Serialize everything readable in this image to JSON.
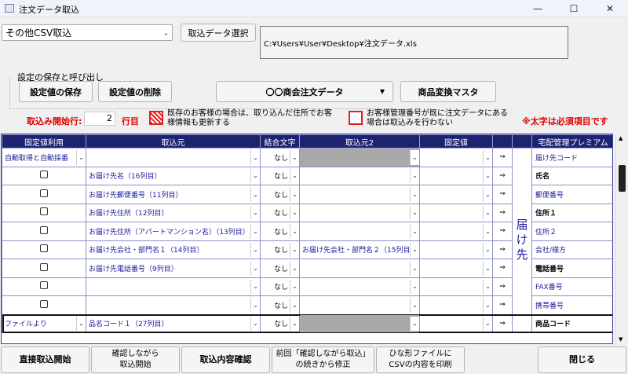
{
  "window": {
    "title": "注文データ取込",
    "min": "—",
    "max": "☐",
    "close": "✕"
  },
  "top": {
    "import_type": "その他CSV取込",
    "select_btn": "取込データ選択",
    "path": "C:¥Users¥User¥Desktop¥注文データ.xls"
  },
  "settings": {
    "group_label": "設定の保存と呼び出し",
    "save_btn": "設定値の保存",
    "delete_btn": "設定値の削除",
    "preset": "〇〇商会注文データ",
    "product_master_btn": "商品変換マスタ"
  },
  "options": {
    "start_label": "取込み開始行:",
    "start_value": "2",
    "row_label": "行目",
    "opt1": "既存のお客様の場合は、取り込んだ住所でお客様情報も更新する",
    "opt2": "お客様管理番号が既に注文データにある場合は取込みを行わない",
    "required_note": "※太字は必須項目です"
  },
  "grid": {
    "headers": [
      "固定値利用",
      "取込元",
      "結合文字",
      "取込元2",
      "固定値",
      "",
      "",
      "宅配管理プレミアム"
    ],
    "dest_group": "届け先",
    "rows": [
      {
        "fixed": "自動取得と自動採番",
        "src": "",
        "join": "なし",
        "src2": "",
        "src2_gray": true,
        "value": "",
        "out": "届け先コード",
        "bold": false
      },
      {
        "fixed": "",
        "src": "お届け先名（16列目）",
        "join": "なし",
        "src2": "",
        "value": "",
        "out": "氏名",
        "bold": true
      },
      {
        "fixed": "",
        "src": "お届け先郵便番号（11列目）",
        "join": "なし",
        "src2": "",
        "value": "",
        "out": "郵便番号",
        "bold": false
      },
      {
        "fixed": "",
        "src": "お届け先住所（12列目）",
        "join": "なし",
        "src2": "",
        "value": "",
        "out": "住所１",
        "bold": true
      },
      {
        "fixed": "",
        "src": "お届け先住所（アパートマンション名）（13列目）",
        "join": "なし",
        "src2": "",
        "value": "",
        "out": "住所２",
        "bold": false
      },
      {
        "fixed": "",
        "src": "お届け先会社・部門名１（14列目）",
        "join": "なし",
        "src2": "お届け先会社・部門名２（15列目）",
        "value": "",
        "out": "会社/様方",
        "bold": false
      },
      {
        "fixed": "",
        "src": "お届け先電話番号（9列目）",
        "join": "なし",
        "src2": "",
        "value": "",
        "out": "電話番号",
        "bold": true
      },
      {
        "fixed": "",
        "src": "",
        "join": "なし",
        "src2": "",
        "value": "",
        "out": "FAX番号",
        "bold": false
      },
      {
        "fixed": "",
        "src": "",
        "join": "なし",
        "src2": "",
        "value": "",
        "out": "携帯番号",
        "bold": false
      },
      {
        "fixed": "ファイルより",
        "src": "品名コード１（27列目）",
        "join": "なし",
        "src2": "",
        "src2_gray": true,
        "value": "",
        "out": "商品コード",
        "bold": true
      }
    ],
    "arrow": "⇒"
  },
  "bottom": {
    "b1": "直接取込開始",
    "b2a": "確認しながら",
    "b2b": "取込開始",
    "b3": "取込内容確認",
    "b4a": "前回「確認しながら取込」",
    "b4b": "の続きから修正",
    "b5a": "ひな形ファイルに",
    "b5b": "CSVの内容を印刷",
    "close": "閉じる"
  }
}
